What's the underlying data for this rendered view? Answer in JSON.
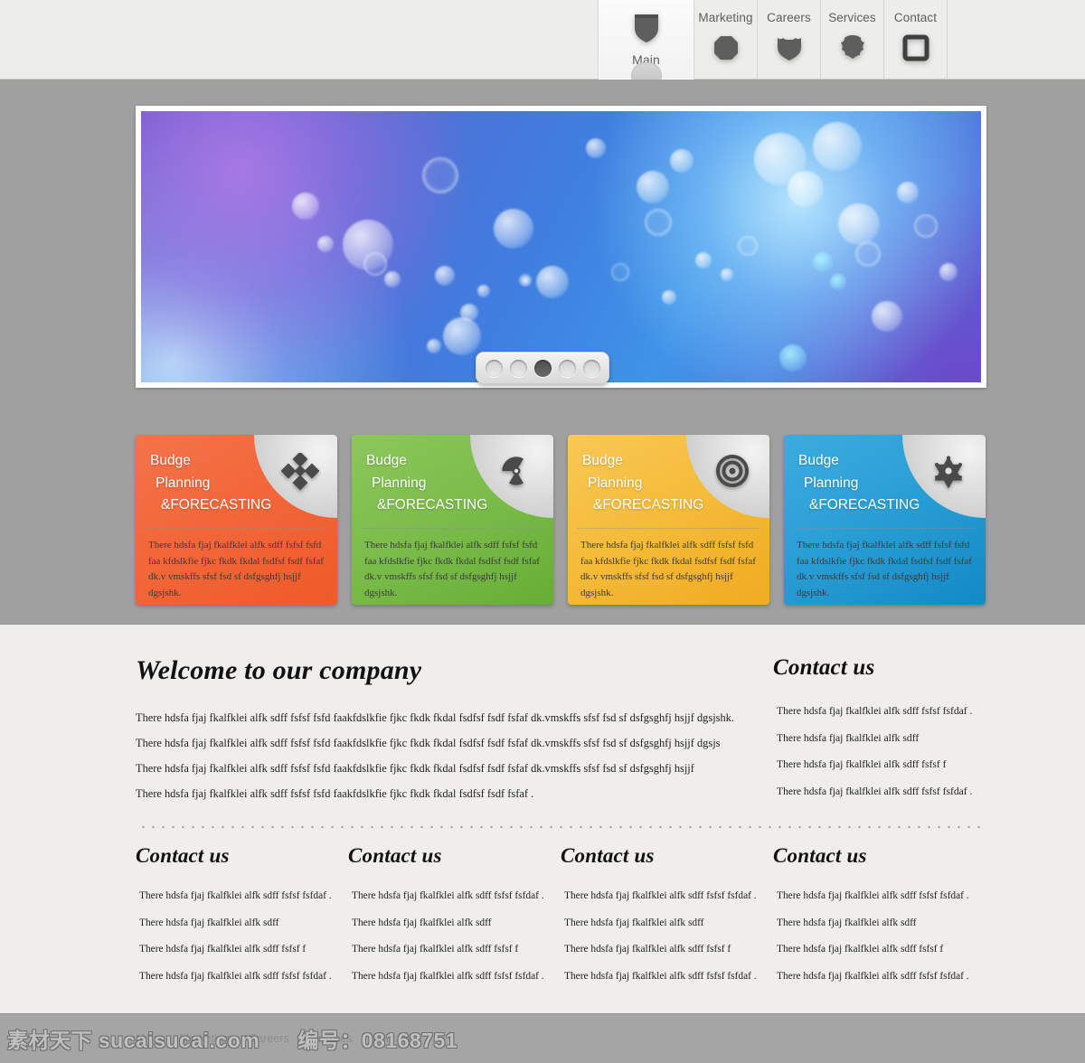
{
  "theme": {
    "header_bg": "#ededec",
    "hero_band_bg": "#a0a0a0",
    "content_bg": "#efeeed",
    "footer_bg": "#a5a5a5",
    "card_orange": "#f2673a",
    "card_green": "#7cbd4b",
    "card_yellow": "#f5bc3b",
    "card_blue": "#2a9fd6"
  },
  "nav": {
    "items": [
      {
        "label": "Main",
        "icon": "shield-icon",
        "active": true
      },
      {
        "label": "Marketing",
        "icon": "octagon-icon",
        "active": false
      },
      {
        "label": "Careers",
        "icon": "crest-shield-icon",
        "active": false
      },
      {
        "label": "Services",
        "icon": "badge-shield-icon",
        "active": false
      },
      {
        "label": "Contact",
        "icon": "square-outline-icon",
        "active": false
      }
    ]
  },
  "slider": {
    "slide_alt": "blue purple bokeh lights banner",
    "dots": [
      {
        "index": 1,
        "active": false
      },
      {
        "index": 2,
        "active": false
      },
      {
        "index": 3,
        "active": true
      },
      {
        "index": 4,
        "active": false
      },
      {
        "index": 5,
        "active": false
      }
    ]
  },
  "cards": [
    {
      "color": "#f2673a",
      "color_dark": "#e0421c",
      "icon": "four-diamonds-icon",
      "line1": "Budge",
      "line2": "Planning",
      "line3": "&FORECASTING",
      "body": "There hdsfa  fjaj fkalfklei alfk sdff fsfsf fsfd faa kfdslkfie fjkc fkdk  fkdal  fsdfsf  fsdf   fsfaf dk.v vmskffs  sfsf fsd sf dsfgsghfj hsjjf  dgsjshk."
    },
    {
      "color": "#7cbd4b",
      "color_dark": "#5ba230",
      "icon": "radiation-icon",
      "line1": "Budge",
      "line2": "Planning",
      "line3": "&FORECASTING",
      "body": "There hdsfa  fjaj fkalfklei alfk sdff fsfsf fsfd faa kfdslkfie fjkc fkdk  fkdal  fsdfsf  fsdf   fsfaf dk.v vmskffs  sfsf fsd sf dsfgsghfj hsjjf  dgsjshk."
    },
    {
      "color": "#f5bc3b",
      "color_dark": "#eda51f",
      "icon": "target-icon",
      "line1": "Budge",
      "line2": "Planning",
      "line3": "&FORECASTING",
      "body": "There hdsfa  fjaj fkalfklei alfk sdff fsfsf fsfd faa kfdslkfie fjkc fkdk  fkdal  fsdfsf  fsdf   fsfaf dk.v vmskffs  sfsf fsd sf dsfgsghfj hsjjf  dgsjshk."
    },
    {
      "color": "#2a9fd6",
      "color_dark": "#0f86c0",
      "icon": "sheriff-star-icon",
      "line1": "Budge",
      "line2": "Planning",
      "line3": "&FORECASTING",
      "body": "There hdsfa  fjaj fkalfklei alfk sdff fsfsf fsfd faa kfdslkfie fjkc fkdk  fkdal  fsdfsf  fsdf   fsfaf dk.v vmskffs  sfsf fsd sf dsfgsghfj hsjjf  dgsjshk."
    }
  ],
  "welcome": {
    "title": "Welcome to our company",
    "paragraphs": [
      "There hdsfa  fjaj fkalfklei alfk sdff fsfsf fsfd faakfdslkfie fjkc fkdk  fkdal  fsdfsf  fsdf   fsfaf dk.vmskffs  sfsf fsd sf dsfgsghfj hsjjf  dgsjshk.",
      "There hdsfa  fjaj fkalfklei alfk sdff fsfsf fsfd faakfdslkfie fjkc fkdk  fkdal  fsdfsf  fsdf   fsfaf dk.vmskffs  sfsf fsd sf dsfgsghfj hsjjf  dgsjs",
      "There hdsfa  fjaj fkalfklei alfk sdff fsfsf fsfd faakfdslkfie fjkc fkdk  fkdal  fsdfsf  fsdf   fsfaf dk.vmskffs  sfsf fsd sf dsfgsghfj hsjjf",
      "There hdsfa  fjaj fkalfklei alfk sdff fsfsf fsfd faakfdslkfie fjkc fkdk  fkdal  fsdfsf  fsdf   fsfaf ."
    ]
  },
  "contact_side": {
    "title": "Contact us",
    "paragraphs": [
      "There hdsfa  fjaj fkalfklei alfk sdff fsfsf fsfdaf .",
      "There hdsfa  fjaj fkalfklei alfk sdff",
      "There hdsfa  fjaj fkalfklei alfk sdff fsfsf f",
      "There hdsfa  fjaj fkalfklei alfk sdff fsfsf fsfdaf ."
    ]
  },
  "bottom_columns": [
    {
      "title": "Contact us",
      "paragraphs": [
        "There hdsfa  fjaj fkalfklei alfk sdff fsfsf fsfdaf .",
        "There hdsfa  fjaj fkalfklei alfk sdff",
        "There hdsfa  fjaj fkalfklei alfk sdff fsfsf f",
        "There hdsfa  fjaj fkalfklei alfk sdff fsfsf fsfdaf ."
      ]
    },
    {
      "title": "Contact us",
      "paragraphs": [
        "There hdsfa  fjaj fkalfklei alfk sdff fsfsf fsfdaf .",
        "There hdsfa  fjaj fkalfklei alfk sdff",
        "There hdsfa  fjaj fkalfklei alfk sdff fsfsf f",
        "There hdsfa  fjaj fkalfklei alfk sdff fsfsf fsfdaf ."
      ]
    },
    {
      "title": "Contact us",
      "paragraphs": [
        "There hdsfa  fjaj fkalfklei alfk sdff fsfsf fsfdaf .",
        "There hdsfa  fjaj fkalfklei alfk sdff",
        "There hdsfa  fjaj fkalfklei alfk sdff fsfsf f",
        "There hdsfa  fjaj fkalfklei alfk sdff fsfsf fsfdaf ."
      ]
    },
    {
      "title": "Contact us",
      "paragraphs": [
        "There hdsfa  fjaj fkalfklei alfk sdff fsfsf fsfdaf .",
        "There hdsfa  fjaj fkalfklei alfk sdff",
        "There hdsfa  fjaj fkalfklei alfk sdff fsfsf f",
        "There hdsfa  fjaj fkalfklei alfk sdff fsfsf fsfdaf ."
      ]
    }
  ],
  "footer": {
    "links": [
      "Main",
      "Marketing",
      "Careers",
      "Services",
      "Contact"
    ],
    "separator": "·",
    "watermark_left": "素材天下 sucaisucai.com",
    "watermark_right": "编号：08168751"
  }
}
